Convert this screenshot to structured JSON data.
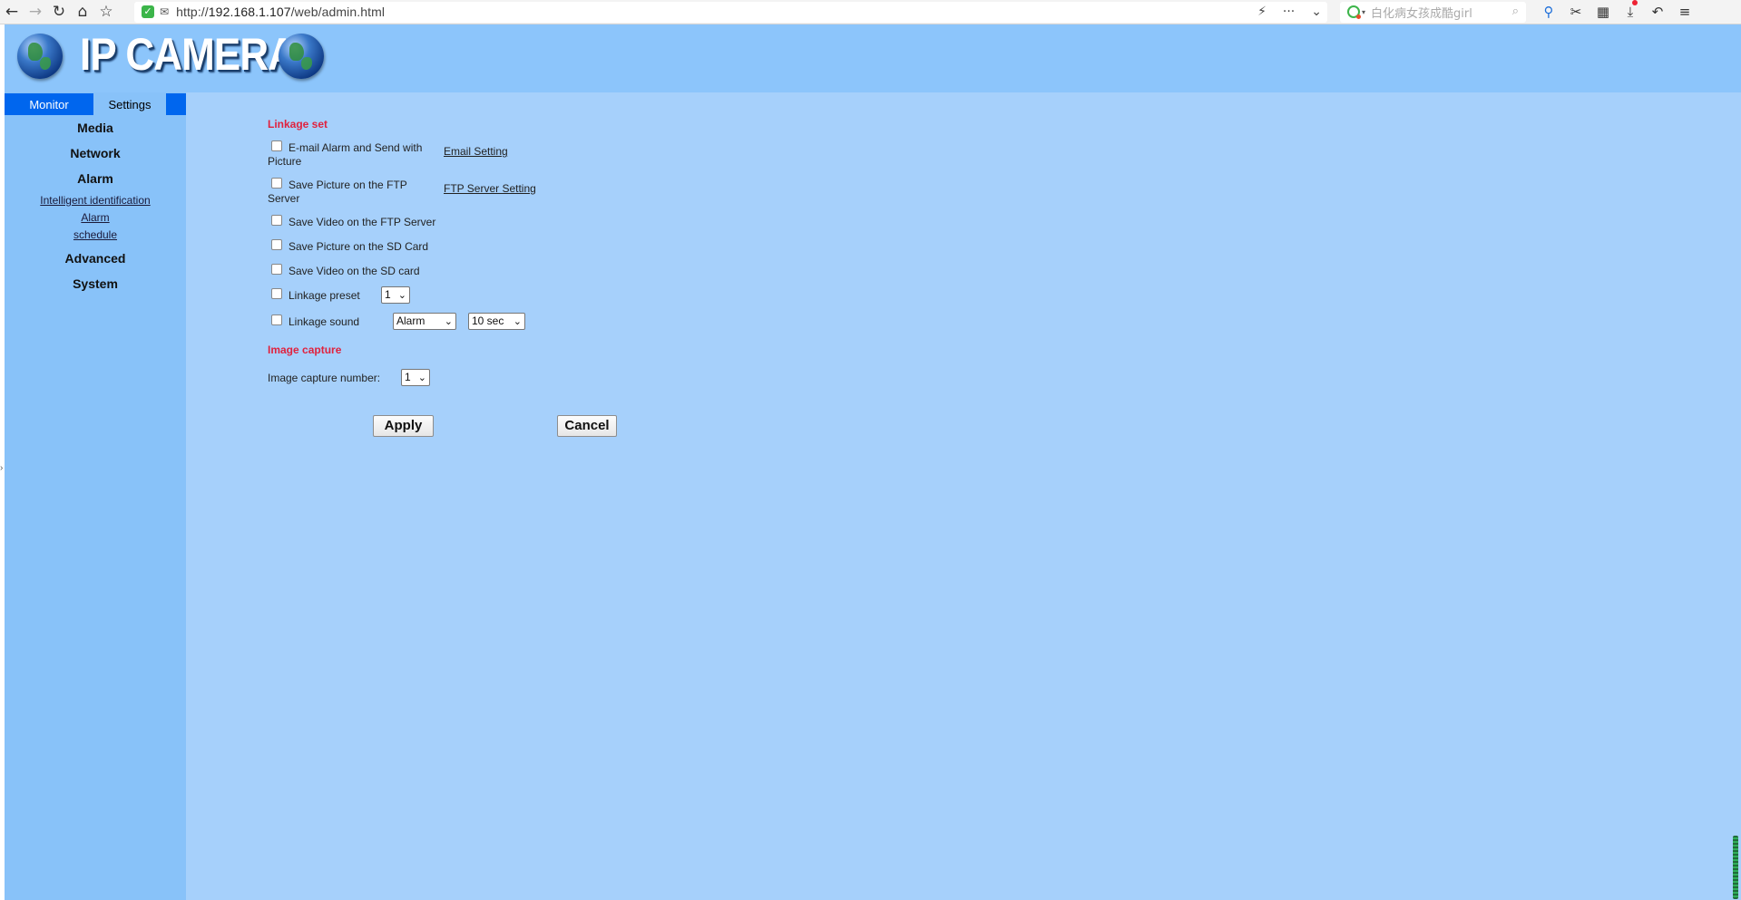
{
  "browser": {
    "url_prefix": "http://",
    "url_host": "192.168.1.107",
    "url_path": "/web/admin.html",
    "search_placeholder": "白化病女孩成酷girl",
    "icons": [
      "back-icon",
      "forward-icon",
      "reload-icon",
      "home-icon",
      "bookmark-star-icon",
      "shield-icon",
      "site-info-icon",
      "lightning-icon",
      "more-icon",
      "dropdown-icon",
      "search-logo-icon",
      "magnifier-icon",
      "zoom-icon",
      "scissors-icon",
      "apps-grid-icon",
      "download-icon",
      "undo-icon",
      "menu-icon"
    ]
  },
  "header": {
    "logo_text": "IP CAMERA"
  },
  "sidebar": {
    "tab_monitor": "Monitor",
    "tab_settings": "Settings",
    "menu": {
      "media": "Media",
      "network": "Network",
      "alarm": "Alarm",
      "advanced": "Advanced",
      "system": "System"
    },
    "alarm_sub": {
      "intelligent": "Intelligent identification",
      "alarm": "Alarm",
      "schedule": "schedule"
    }
  },
  "linkage": {
    "title": "Linkage set",
    "email_label_1": "E-mail Alarm and Send with",
    "email_label_2": "Picture",
    "email_link": "Email Setting",
    "ftp_pic_label_1": "Save Picture on the FTP",
    "ftp_pic_label_2": "Server",
    "ftp_link": "FTP Server Setting",
    "ftp_video_label": "Save Video on the FTP Server",
    "sd_pic_label": "Save Picture on the SD Card",
    "sd_video_label": "Save Video on the SD card",
    "preset_label": "Linkage preset",
    "preset_value": "1",
    "sound_label": "Linkage sound",
    "sound_value": "Alarm",
    "duration_value": "10 sec"
  },
  "capture": {
    "title": "Image capture",
    "number_label": "Image capture number:",
    "number_value": "1"
  },
  "actions": {
    "apply": "Apply",
    "cancel": "Cancel"
  }
}
